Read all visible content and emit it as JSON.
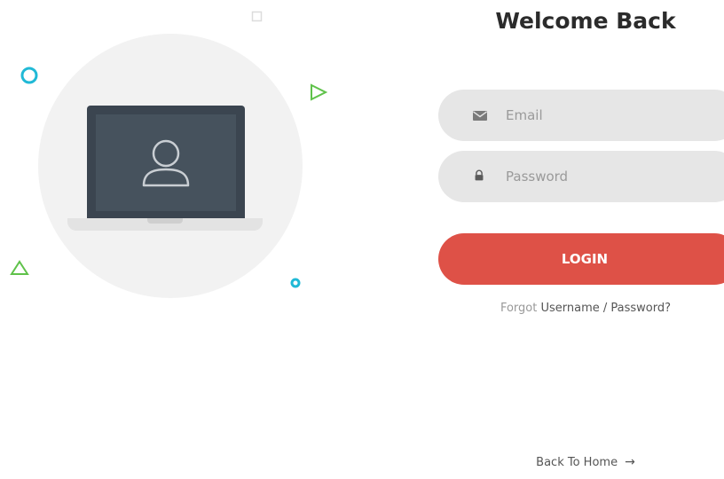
{
  "title": "Welcome Back",
  "email": {
    "placeholder": "Email",
    "icon": "envelope-icon"
  },
  "password": {
    "placeholder": "Password",
    "icon": "lock-icon"
  },
  "login": {
    "label": "LOGIN",
    "color": "#de5147"
  },
  "forgot": {
    "prefix": "Forgot",
    "link": "Username / Password?"
  },
  "back_home": {
    "label": "Back To Home",
    "arrow": "→"
  },
  "colors": {
    "accent_red": "#de5147",
    "deco_blue": "#20b9d6",
    "deco_green": "#5fc24a",
    "field_bg": "#e6e6e6"
  }
}
